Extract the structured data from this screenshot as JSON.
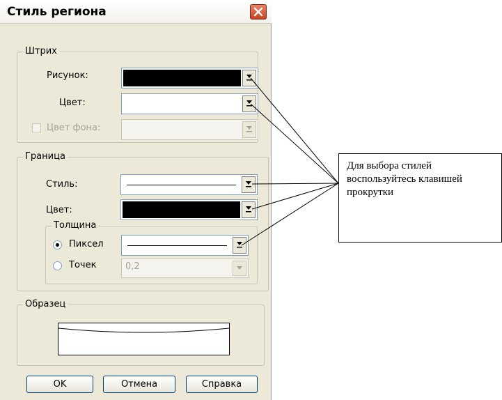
{
  "dialog": {
    "title": "Стиль региона",
    "close_icon": "close-x-icon"
  },
  "stroke_group": {
    "legend": "Штрих",
    "pattern_label": "Рисунок:",
    "color_label": "Цвет:",
    "bg_color_label": "Цвет фона:",
    "bg_color_checked": false,
    "bg_color_enabled": false
  },
  "border_group": {
    "legend": "Граница",
    "style_label": "Стиль:",
    "color_label": "Цвет:"
  },
  "thickness_group": {
    "legend": "Толщина",
    "pixel_label": "Пиксел",
    "points_label": "Точек",
    "selected": "Пиксел",
    "points_value": "0,2"
  },
  "sample_group": {
    "legend": "Образец"
  },
  "buttons": {
    "ok": "OK",
    "cancel": "Отмена",
    "help": "Справка"
  },
  "annotation": {
    "text": "Для выбора стилей воспользуйтесь клавишей прокрутки"
  },
  "colors": {
    "dialog_bg": "#ece9d8",
    "swatch_black": "#000000",
    "close_red": "#c8401f",
    "input_border": "#7f9db9"
  }
}
